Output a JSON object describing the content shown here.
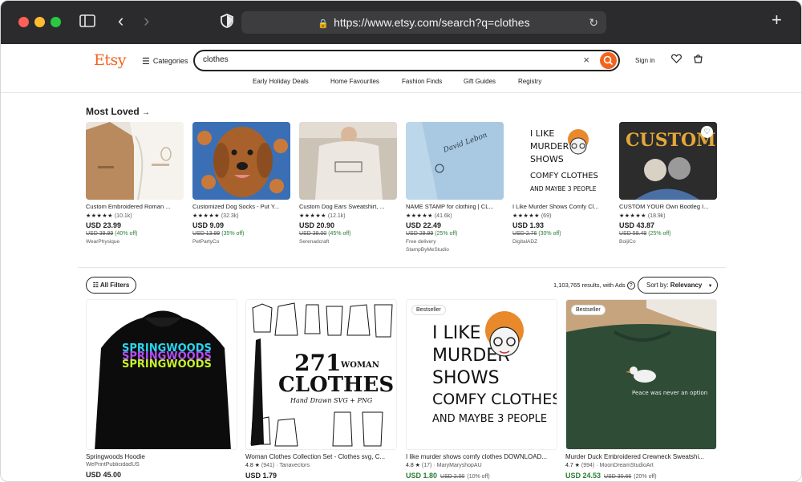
{
  "browser": {
    "url": "https://www.etsy.com/search?q=clothes"
  },
  "header": {
    "logo": "Etsy",
    "categories_label": "Categories",
    "search_value": "clothes",
    "sign_in": "Sign in",
    "nav": [
      "Early Holiday Deals",
      "Home Favourites",
      "Fashion Finds",
      "Gift Guides",
      "Registry"
    ]
  },
  "most_loved": {
    "title": "Most Loved",
    "arrow": "→",
    "items": [
      {
        "title": "Custom Embroidered Roman ...",
        "stars": "★★★★★",
        "count": "(10.1k)",
        "price": "USD 23.99",
        "orig": "USD 39.99",
        "disc": "(40% off)",
        "shop": "WearPhysique"
      },
      {
        "title": "Customized Dog Socks - Put Y...",
        "stars": "★★★★★",
        "count": "(32.3k)",
        "price": "USD 9.09",
        "orig": "USD 13.99",
        "disc": "(35% off)",
        "shop": "PetPartyCo"
      },
      {
        "title": "Custom Dog Ears Sweatshirt, ...",
        "stars": "★★★★★",
        "count": "(12.1k)",
        "price": "USD 20.90",
        "orig": "USD 38.00",
        "disc": "(45% off)",
        "shop": "Serenadcraft"
      },
      {
        "title": "NAME STAMP for clothing | CL...",
        "stars": "★★★★★",
        "count": "(41.6k)",
        "price": "USD 22.49",
        "orig": "USD 29.99",
        "disc": "(25% off)",
        "extra": "Free delivery",
        "shop": "StampByMeStudio"
      },
      {
        "title": "I Like Murder Shows Comfy Cl...",
        "stars": "★★★★★",
        "count": "(69)",
        "price": "USD 1.93",
        "orig": "USD 2.76",
        "disc": "(30% off)",
        "shop": "DigitalADZ"
      },
      {
        "title": "CUSTOM YOUR Own Bootleg I...",
        "stars": "★★★★★",
        "count": "(18.9k)",
        "price": "USD 43.87",
        "orig": "USD 58.49",
        "disc": "(25% off)",
        "shop": "BoijiCo"
      }
    ]
  },
  "filters": {
    "all_filters": "All Filters",
    "results_text": "1,103,765 results, with Ads",
    "sort_label": "Sort by: ",
    "sort_value": "Relevancy"
  },
  "results": [
    {
      "title": "Springwoods Hoodie",
      "meta": "WePrintPublicidadUS",
      "price": "USD 45.00",
      "badge": ""
    },
    {
      "title": "Woman Clothes Collection Set - Clothes svg, C...",
      "rating": "4.8 ★",
      "count": "(941)",
      "shop": "Tanavectors",
      "price": "USD 1.79",
      "badge": ""
    },
    {
      "title": "I like murder shows comfy clothes DOWNLOAD...",
      "rating": "4.8 ★",
      "count": "(17)",
      "shop": "MaryMaryshopAU",
      "price": "USD 1.80",
      "orig": "USD 2.00",
      "disc": "(10% off)",
      "badge": "Bestseller"
    },
    {
      "title": "Murder Duck Embroidered Crewneck Sweatshi...",
      "rating": "4.7 ★",
      "count": "(994)",
      "shop": "MoonDreamStudioArt",
      "price": "USD 24.53",
      "orig": "USD 30.66",
      "disc": "(20% off)",
      "badge": "Bestseller"
    }
  ],
  "art": {
    "springwoods_text": "SPRINGWOODS",
    "clothes_num": "271",
    "clothes_word": "WOMAN",
    "clothes_title": "CLOTHES",
    "clothes_sub": "Hand Drawn SVG + PNG",
    "murder_lines": [
      "I LIKE",
      "MURDER",
      "SHOWS",
      "COMFY CLOTHES",
      "AND MAYBE 3 PEOPLE"
    ],
    "duck_text": "Peace was never an option",
    "custom_text": "CUSTOM",
    "stamp_text": "David Lebon"
  },
  "colors": {
    "accent": "#f1641e",
    "sale": "#2a7d35",
    "chrome": "#2b2b2d"
  }
}
